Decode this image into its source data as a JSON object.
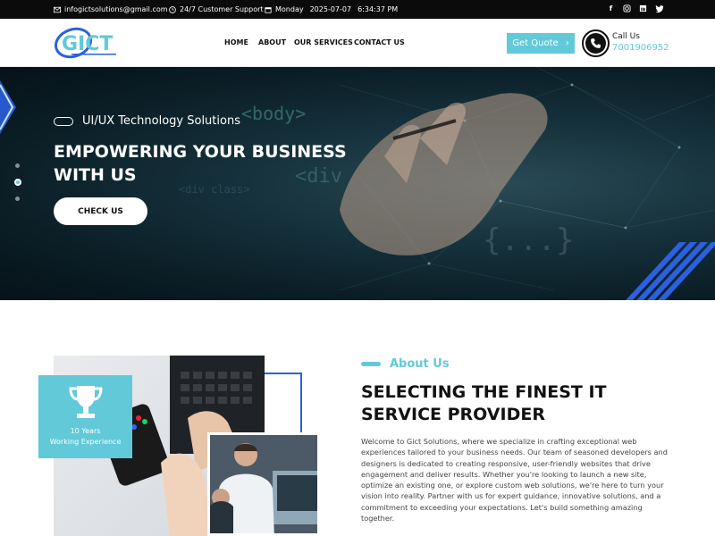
{
  "topbar": {
    "email": "infogictsolutions@gmail.com",
    "support": "24/7 Customer Support",
    "day": "Monday",
    "date": "2025-07-07",
    "time": "6:34:37 PM",
    "social": [
      "facebook-icon",
      "instagram-icon",
      "linkedin-icon",
      "twitter-icon"
    ]
  },
  "header": {
    "logo_text": "GICT",
    "nav": [
      "HOME",
      "ABOUT",
      "OUR SERVICES",
      "CONTACT US"
    ],
    "quote_label": "Get Quote",
    "call_label": "Call Us",
    "call_number": "7001906952"
  },
  "hero": {
    "subtitle": "UI/UX Technology Solutions",
    "title": "EMPOWERING YOUR BUSINESS WITH US",
    "button": "CHECK US"
  },
  "about": {
    "years": "10 Years",
    "experience": "Working Experience",
    "tag": "About Us",
    "title": "SELECTING THE FINEST IT SERVICE PROVIDER",
    "text": "Welcome to Gict Solutions, where we specialize in crafting exceptional web experiences tailored to your business needs. Our team of seasoned developers and designers is dedicated to creating responsive, user-friendly websites that drive engagement and deliver results. Whether you're looking to launch a new site, optimize an existing one, or explore custom web solutions, we're here to turn your vision into reality. Partner with us for expert guidance, innovative solutions, and a commitment to exceeding your expectations. Let's build something amazing together."
  },
  "colors": {
    "accent": "#62c9d9",
    "blue": "#2b60e0",
    "dark": "#0b0b0b"
  }
}
